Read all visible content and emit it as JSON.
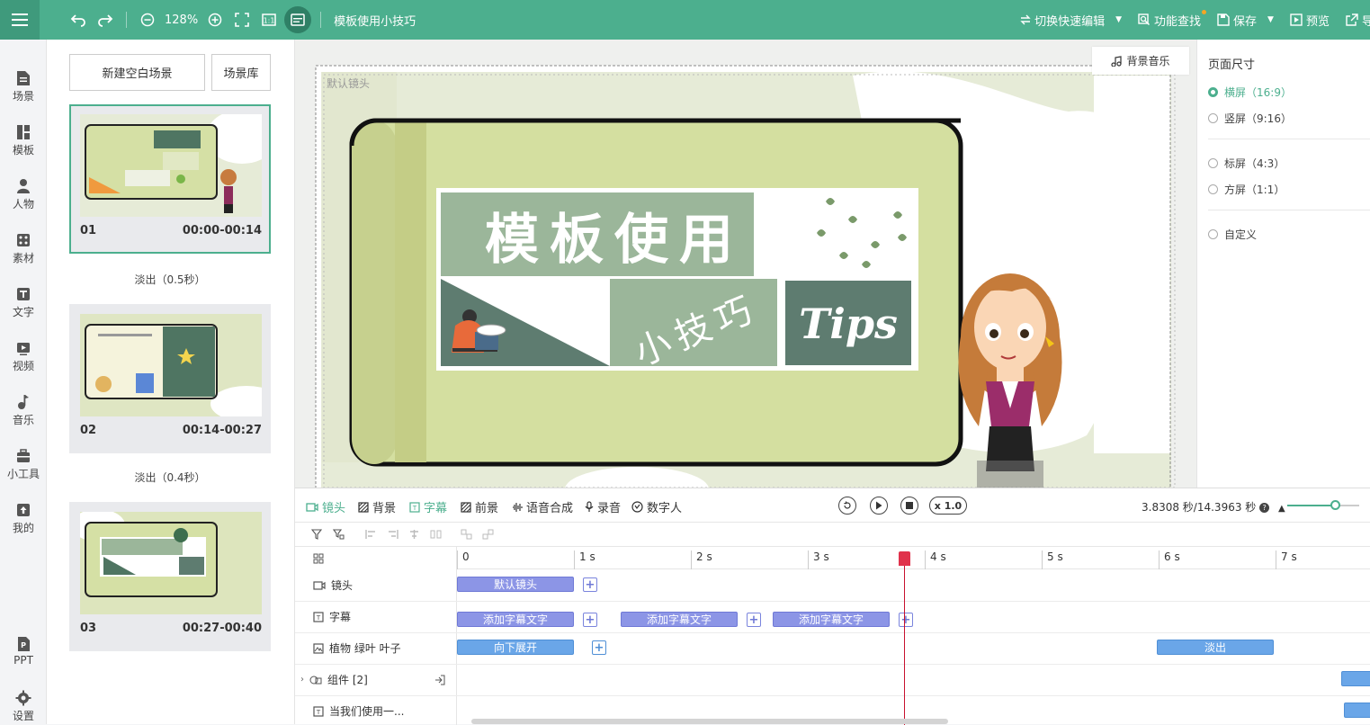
{
  "toolbar": {
    "zoom": "128%",
    "title": "模板使用小技巧",
    "switch_edit": "切换快速编辑",
    "feature_search": "功能查找",
    "save": "保存",
    "preview": "预览",
    "export": "导"
  },
  "leftnav": [
    {
      "label": "场景",
      "icon": "doc-icon"
    },
    {
      "label": "模板",
      "icon": "template-icon"
    },
    {
      "label": "人物",
      "icon": "person-icon"
    },
    {
      "label": "素材",
      "icon": "material-icon"
    },
    {
      "label": "文字",
      "icon": "text-icon"
    },
    {
      "label": "视频",
      "icon": "video-icon"
    },
    {
      "label": "音乐",
      "icon": "music-icon"
    },
    {
      "label": "小工具",
      "icon": "toolbox-icon"
    },
    {
      "label": "我的",
      "icon": "upload-icon"
    },
    {
      "label": "PPT",
      "icon": "ppt-icon"
    },
    {
      "label": "设置",
      "icon": "gear-icon"
    }
  ],
  "scenes": {
    "new_blank": "新建空白场景",
    "library": "场景库",
    "items": [
      {
        "num": "01",
        "time": "00:00-00:14"
      },
      {
        "num": "02",
        "time": "00:14-00:27"
      },
      {
        "num": "03",
        "time": "00:27-00:40"
      }
    ],
    "transitions": [
      "淡出（0.5秒）",
      "淡出（0.4秒）"
    ]
  },
  "canvas": {
    "camera_label": "默认镜头",
    "bg_music": "背景音乐",
    "slide_title": "模板使用",
    "slide_subtitle": "小技巧",
    "slide_tips": "Tips"
  },
  "page_size": {
    "title": "页面尺寸",
    "options": [
      {
        "label": "横屏（16:9）",
        "selected": true
      },
      {
        "label": "竖屏（9:16）",
        "selected": false
      },
      {
        "label": "标屏（4:3）",
        "selected": false
      },
      {
        "label": "方屏（1:1）",
        "selected": false
      },
      {
        "label": "自定义",
        "selected": false
      }
    ]
  },
  "timeline": {
    "tabs": [
      "镜头",
      "背景",
      "字幕",
      "前景",
      "语音合成",
      "录音",
      "数字人"
    ],
    "speed": "x 1.0",
    "time": "3.8308 秒/14.3963 秒",
    "ruler": [
      "0",
      "1 s",
      "2 s",
      "3 s",
      "4 s",
      "5 s",
      "6 s",
      "7 s"
    ],
    "tracks": [
      {
        "label": "镜头"
      },
      {
        "label": "字幕"
      },
      {
        "label": "植物 绿叶 叶子"
      },
      {
        "label": "组件 [2]"
      },
      {
        "label": "当我们使用一..."
      }
    ],
    "clips": {
      "camera": "默认镜头",
      "subtitle": "添加字幕文字",
      "expand": "向下展开",
      "fadeout": "淡出"
    }
  },
  "colors": {
    "accent": "#4caf8e",
    "clip": "#8c95e6",
    "clip_blue": "#6aa6e8",
    "playhead": "#c8102e"
  }
}
